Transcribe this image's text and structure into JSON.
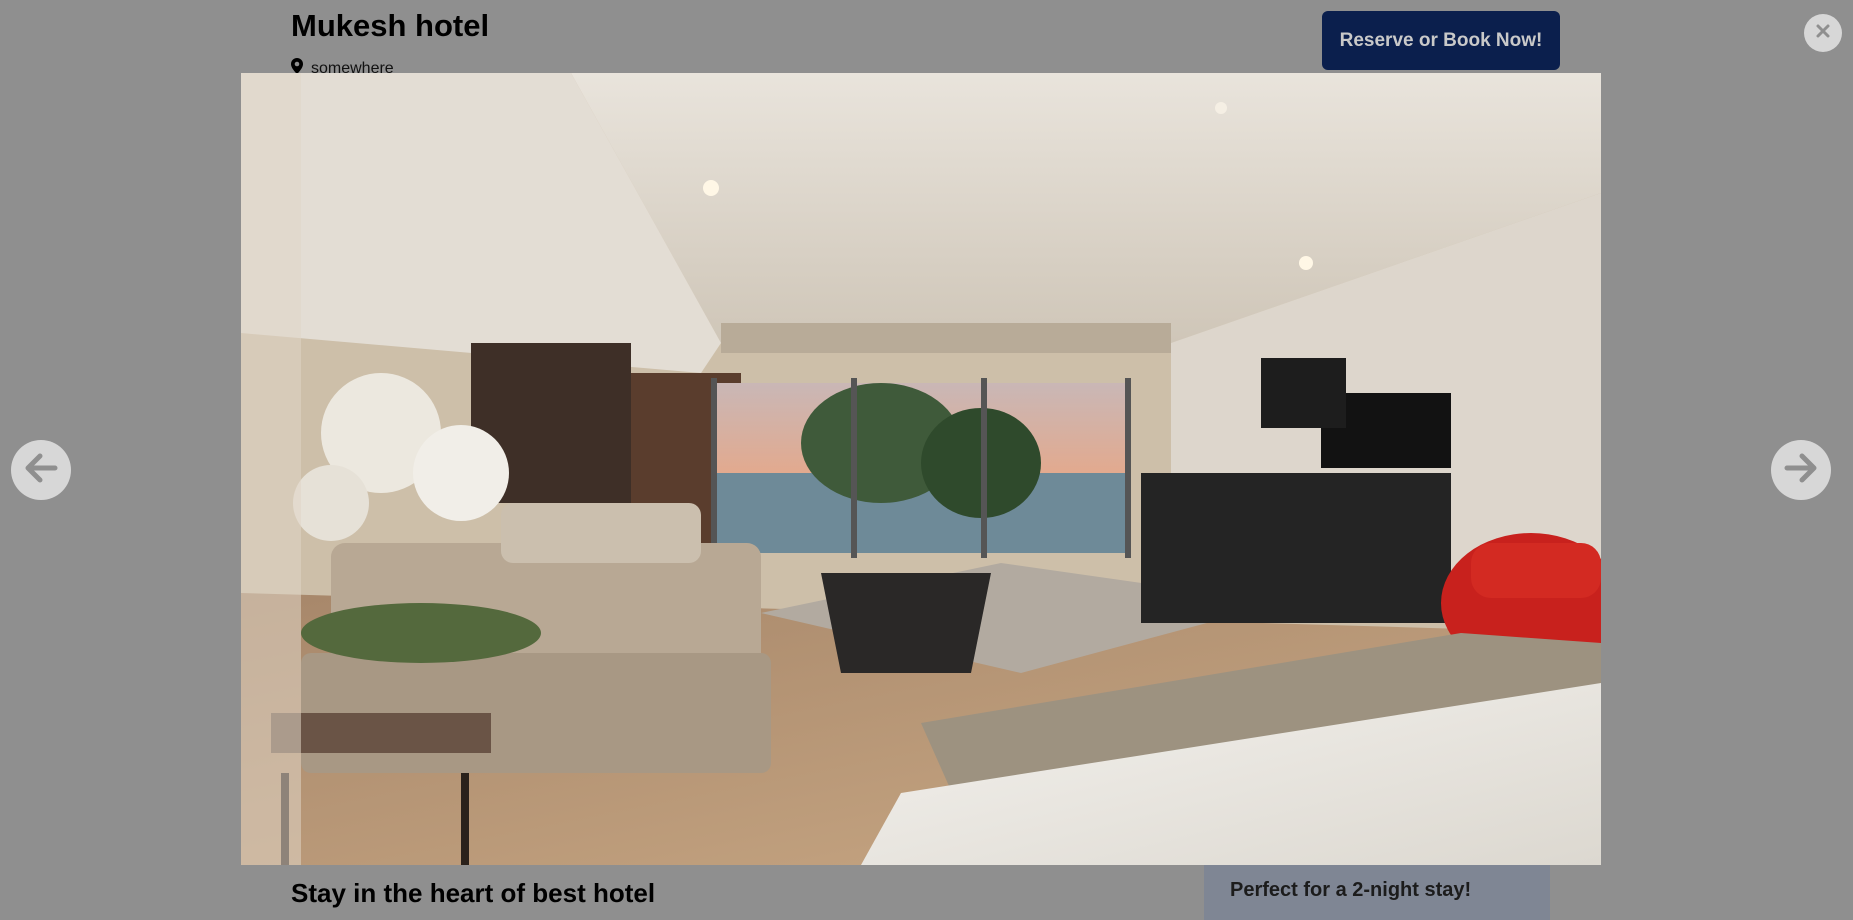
{
  "hotel": {
    "name": "Mukesh hotel",
    "location": "somewhere"
  },
  "actions": {
    "reserve_label": "Reserve or Book Now!"
  },
  "icons": {
    "close": "close-icon",
    "prev": "arrow-left-icon",
    "next": "arrow-right-icon",
    "location": "map-pin-icon"
  },
  "details": {
    "heading": "Stay in the heart of best hotel",
    "stay_note": "Perfect for a 2-night stay!"
  },
  "colors": {
    "overlay": "#8f8f8f",
    "primary_button": "#0b1f4d",
    "nav_button": "#d7d7d7",
    "stay_box": "#7f8694"
  }
}
